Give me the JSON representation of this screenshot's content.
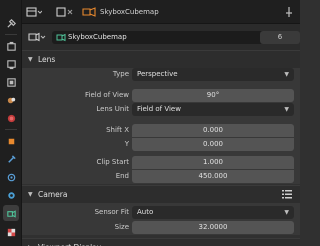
{
  "header": {
    "object_name": "SkyboxCubemap"
  },
  "camera_data": {
    "name": "SkyboxCubemap",
    "users": "6"
  },
  "lens": {
    "title": "Lens",
    "type_label": "Type",
    "type_value": "Perspective",
    "fov_label": "Field of View",
    "fov_value": "90°",
    "unit_label": "Lens Unit",
    "unit_value": "Field of View",
    "shiftx_label": "Shift X",
    "shiftx_value": "0.000",
    "shifty_label": "Y",
    "shifty_value": "0.000",
    "clipstart_label": "Clip Start",
    "clipstart_value": "1.000",
    "clipend_label": "End",
    "clipend_value": "450.000"
  },
  "camera": {
    "title": "Camera",
    "sensor_fit_label": "Sensor Fit",
    "sensor_fit_value": "Auto",
    "size_label": "Size",
    "size_value": "32.0000"
  },
  "viewport_display": {
    "title": "Viewport Display"
  },
  "icons": [
    "tool-icon",
    "render-icon",
    "output-icon",
    "view-layer-icon",
    "scene-icon",
    "world-icon",
    "object-icon",
    "modifier-icon",
    "particles-icon",
    "physics-icon",
    "constraints-icon",
    "camera-data-icon",
    "texture-icon"
  ],
  "colors": {
    "accent_active": "#3d3d3d",
    "panel_bg": "#383838"
  }
}
